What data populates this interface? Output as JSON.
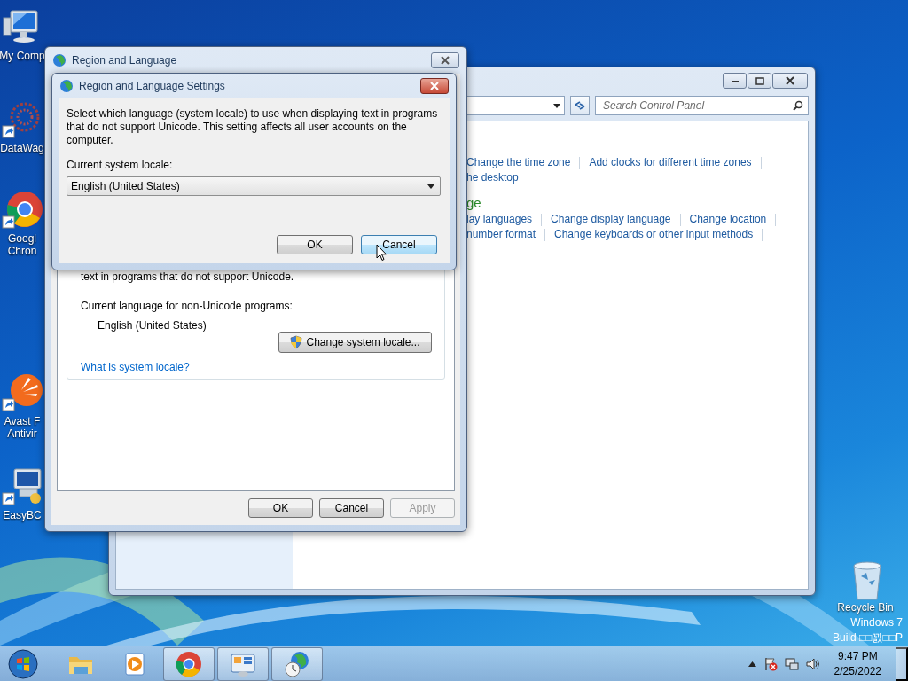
{
  "desktop_icons": [
    {
      "kind": "computer",
      "lines": [
        "My Comp"
      ]
    },
    {
      "kind": "datawag",
      "lines": [
        "DataWag"
      ]
    },
    {
      "kind": "chrome",
      "lines": [
        "Googl",
        "Chron"
      ]
    },
    {
      "kind": "avast",
      "lines": [
        "Avast F",
        "Antivir"
      ]
    },
    {
      "kind": "easybcd",
      "lines": [
        "EasyBC"
      ]
    },
    {
      "kind": "recycle_bin",
      "lines": [
        "Recycle Bin"
      ]
    }
  ],
  "watermark": [
    "Windows 7",
    "Build □□꾌□□P"
  ],
  "control_panel": {
    "search": {
      "placeholder": "Search Control Panel"
    },
    "link_rows": [
      {
        "kind": "links",
        "links": [
          "Change the time zone",
          "Add clocks for different time zones"
        ]
      },
      {
        "kind": "links",
        "links": [
          "he desktop"
        ]
      },
      {
        "kind": "heading",
        "links": [
          "ge"
        ]
      },
      {
        "kind": "links",
        "links": [
          "lay languages",
          "Change display language",
          "Change location"
        ]
      },
      {
        "kind": "links",
        "links": [
          "number format",
          "Change keyboards or other input methods"
        ]
      }
    ]
  },
  "region_window": {
    "title": "Region and Language",
    "group_text": "text in programs that do not support Unicode.",
    "current_label": "Current language for non-Unicode programs:",
    "current_value": "English (United States)",
    "change_button": "Change system locale...",
    "help_link": "What is system locale?",
    "buttons": [
      {
        "label": "OK",
        "disabled": false
      },
      {
        "label": "Cancel",
        "disabled": false
      },
      {
        "label": "Apply",
        "disabled": true
      }
    ]
  },
  "settings_dialog": {
    "title": "Region and Language Settings",
    "description": "Select which language (system locale) to use when displaying text in programs that do not support Unicode. This setting affects all user accounts on the computer.",
    "locale_label": "Current system locale:",
    "locale_value": "English (United States)",
    "buttons": [
      {
        "label": "OK",
        "hovered": false
      },
      {
        "label": "Cancel",
        "hovered": true
      }
    ]
  },
  "taskbar": {
    "items": [
      {
        "kind": "explorer",
        "running": false
      },
      {
        "kind": "media_player",
        "running": false
      },
      {
        "kind": "chrome",
        "running": true
      },
      {
        "kind": "control_panel",
        "running": true
      },
      {
        "kind": "region",
        "running": true
      }
    ],
    "time": "9:47 PM",
    "date": "2/25/2022"
  }
}
